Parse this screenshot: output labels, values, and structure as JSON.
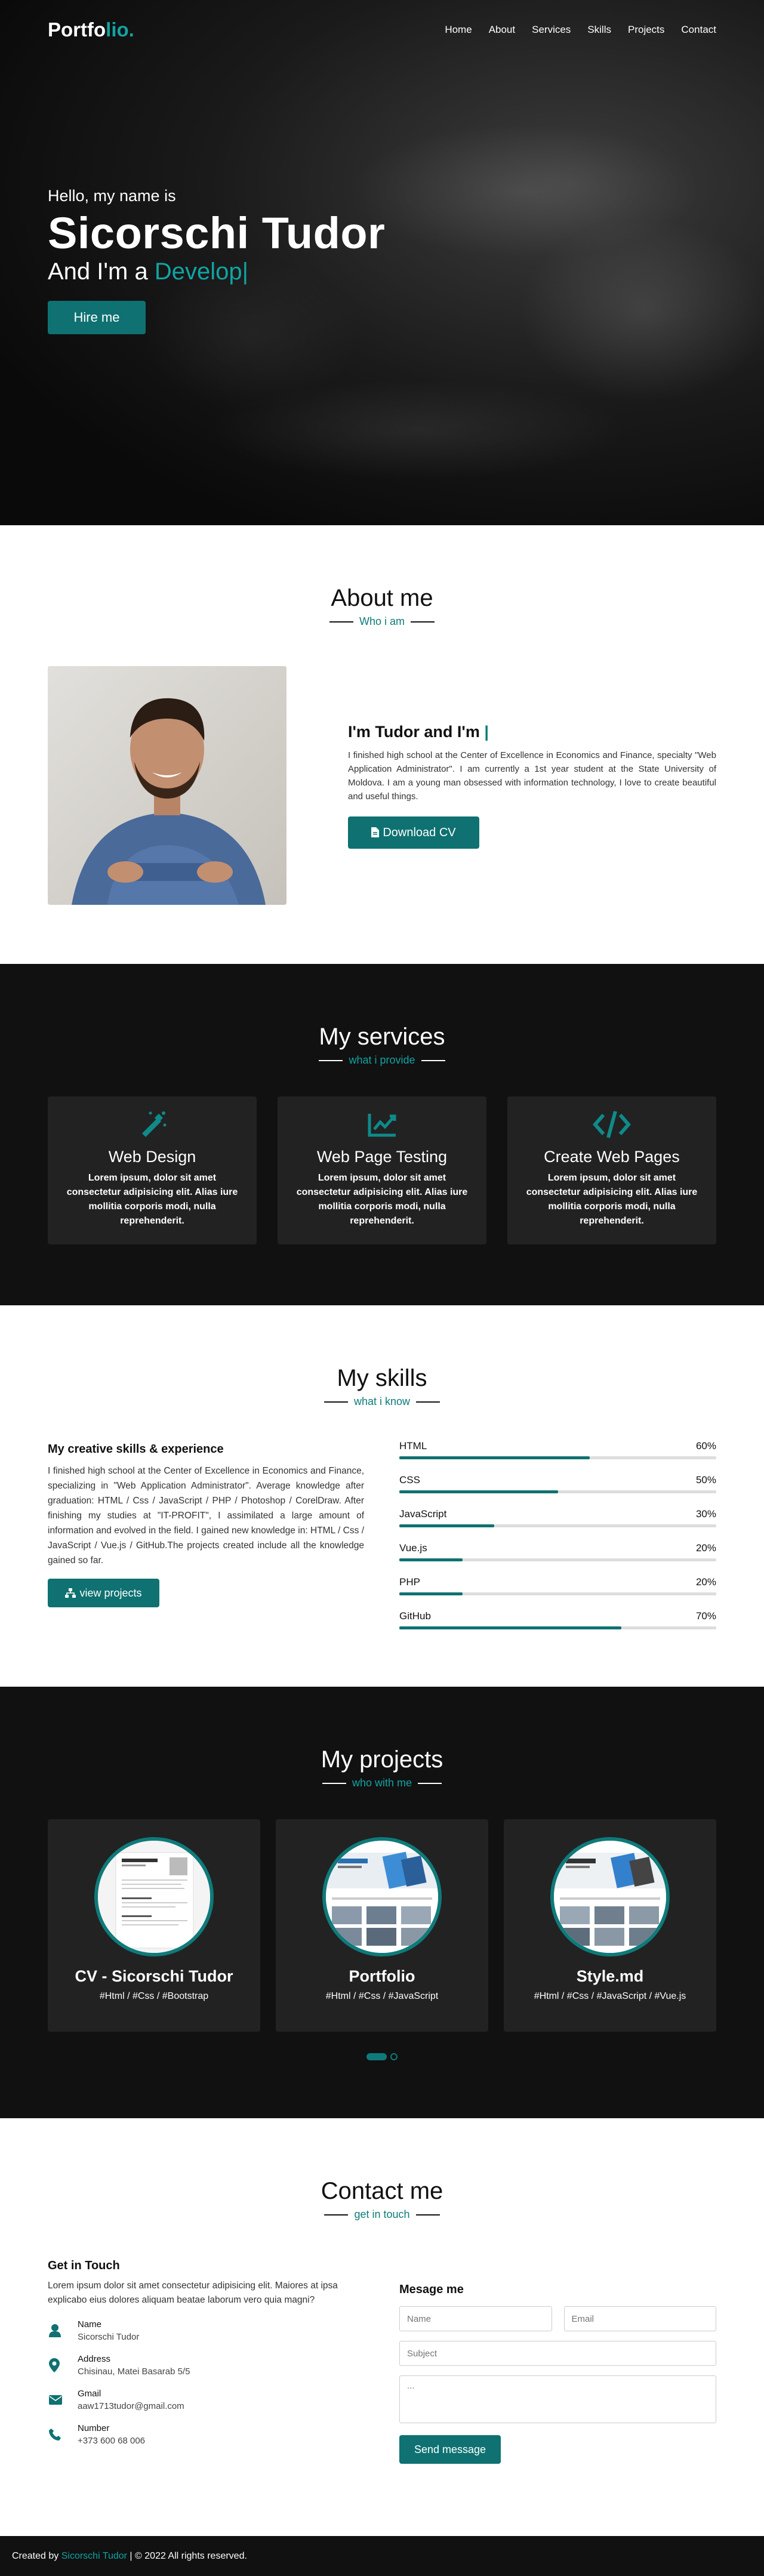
{
  "nav": {
    "logo_main": "Portfo",
    "logo_accent": "lio.",
    "items": [
      "Home",
      "About",
      "Services",
      "Skills",
      "Projects",
      "Contact"
    ]
  },
  "hero": {
    "hello": "Hello, my name is",
    "name": "Sicorschi Tudor",
    "role_prefix": "And I'm a ",
    "role_typed": "Develop|",
    "button": "Hire me"
  },
  "about": {
    "title": "About me",
    "subtitle": "Who i am",
    "heading": "I'm Tudor and I'm ",
    "cursor": "|",
    "text": "I finished high school at the Center of Excellence in Economics and Finance, specialty \"Web Application Administrator\". I am currently a 1st year student at the State University of Moldova. I am a young man obsessed with information technology, I love to create beautiful and useful things.",
    "button": "Download CV"
  },
  "services": {
    "title": "My services",
    "subtitle": "what i provide",
    "cards": [
      {
        "icon": "magic-wand-icon",
        "title": "Web Design",
        "text": "Lorem ipsum, dolor sit amet consectetur adipisicing elit. Alias iure mollitia corporis modi, nulla reprehenderit."
      },
      {
        "icon": "chart-line-icon",
        "title": "Web Page Testing",
        "text": "Lorem ipsum, dolor sit amet consectetur adipisicing elit. Alias iure mollitia corporis modi, nulla reprehenderit."
      },
      {
        "icon": "code-icon",
        "title": "Create Web Pages",
        "text": "Lorem ipsum, dolor sit amet consectetur adipisicing elit. Alias iure mollitia corporis modi, nulla reprehenderit."
      }
    ]
  },
  "skills": {
    "title": "My skills",
    "subtitle": "what i know",
    "heading": "My creative skills & experience",
    "text": "I finished high school at the Center of Excellence in Economics and Finance, specializing in \"Web Application Administrator\". Average knowledge after graduation: HTML / Css / JavaScript / PHP / Photoshop / CorelDraw. After finishing my studies at \"IT-PROFIT\", I assimilated a large amount of information and evolved in the field. I gained new knowledge in: HTML / Css / JavaScript / Vue.js / GitHub.The projects created include all the knowledge gained so far.",
    "button": "view projects",
    "list": [
      {
        "name": "HTML",
        "percent": "60%",
        "value": 60
      },
      {
        "name": "CSS",
        "percent": "50%",
        "value": 50
      },
      {
        "name": "JavaScript",
        "percent": "30%",
        "value": 30
      },
      {
        "name": "Vue.js",
        "percent": "20%",
        "value": 20
      },
      {
        "name": "PHP",
        "percent": "20%",
        "value": 20
      },
      {
        "name": "GitHub",
        "percent": "70%",
        "value": 70
      }
    ]
  },
  "projects": {
    "title": "My projects",
    "subtitle": "who with me",
    "cards": [
      {
        "title": "CV - Sicorschi Tudor",
        "tags": "#Html / #Css / #Bootstrap"
      },
      {
        "title": "Portfolio",
        "tags": "#Html / #Css / #JavaScript"
      },
      {
        "title": "Style.md",
        "tags": "#Html / #Css / #JavaScript / #Vue.js"
      }
    ]
  },
  "contact": {
    "title": "Contact me",
    "subtitle": "get in touch",
    "left_heading": "Get in Touch",
    "left_text": "Lorem ipsum dolor sit amet consectetur adipisicing elit. Maiores at ipsa explicabo eius dolores aliquam beatae laborum vero quia magni?",
    "info": [
      {
        "icon": "user-icon",
        "label": "Name",
        "value": "Sicorschi Tudor"
      },
      {
        "icon": "map-marker-icon",
        "label": "Address",
        "value": "Chisinau, Matei Basarab 5/5"
      },
      {
        "icon": "envelope-icon",
        "label": "Gmail",
        "value": "aaw1713tudor@gmail.com"
      },
      {
        "icon": "phone-icon",
        "label": "Number",
        "value": "+373 600 68 006"
      }
    ],
    "form_heading": "Mesage me",
    "name_placeholder": "Name",
    "email_placeholder": "Email",
    "subject_placeholder": "Subject",
    "message_placeholder": "...",
    "button": "Send message"
  },
  "footer": {
    "prefix": "Created by ",
    "author": "Sicorschi Tudor",
    "suffix": " | © 2022 All rights reserved."
  },
  "colors": {
    "accent": "#0f7171",
    "accent_light": "#12a3a3",
    "dark": "#111111",
    "card": "#222222"
  }
}
